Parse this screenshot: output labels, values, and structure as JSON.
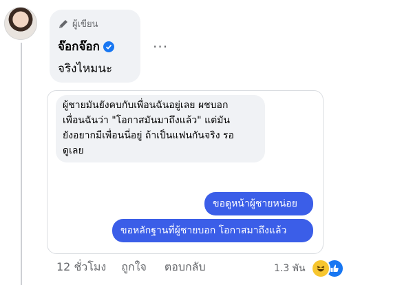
{
  "comment": {
    "author_badge": "ผู้เขียน",
    "author_name": "จ๊อกจ๊อก",
    "text": "จริงไหมนะ",
    "more_label": "···"
  },
  "screenshot": {
    "incoming_message": "ผู้ชายมันยังคบกับเพื่อนฉันอยู่เลย ผชบอก\nเพื่อนฉันว่า \"โอกาสมันมาถึงแล้ว\" แต่มัน\nยังอยากมีเพื่อนนี่อยู่ ถ้าเป็นแฟนกันจริง รอ\nดูเลย",
    "outgoing_messages": [
      "ขอดูหน้าผู้ชายหน่อย",
      "ขอหลักฐานที่ผู้ชายบอก โอกาสมาถึงแล้ว"
    ]
  },
  "actions": {
    "time": "12 ชั่วโมง",
    "like": "ถูกใจ",
    "reply": "ตอบกลับ",
    "reaction_count": "1.3 พัน"
  },
  "colors": {
    "bubble_bg": "#f0f2f5",
    "verified": "#1877f2",
    "outgoing": "#3b5ee8",
    "secondary_text": "#65676b"
  }
}
